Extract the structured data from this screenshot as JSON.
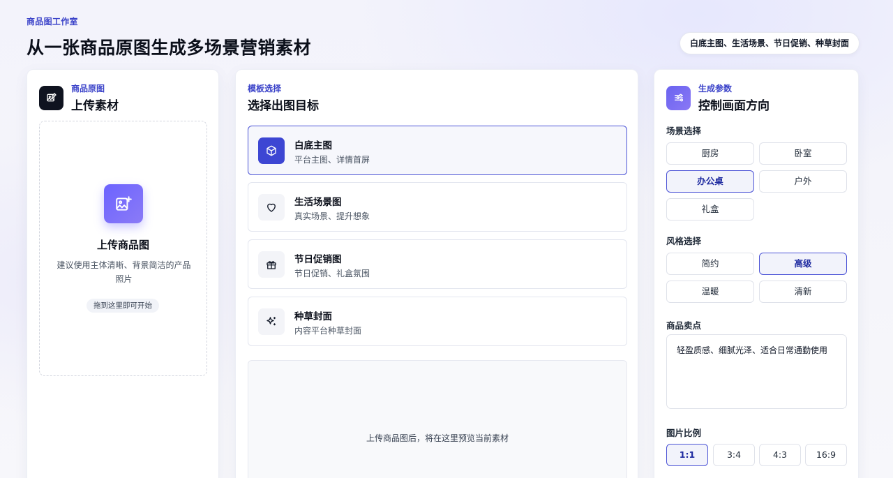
{
  "header": {
    "eyebrow": "商品图工作室",
    "title": "从一张商品原图生成多场景营销素材",
    "pill": "白底主图、生活场景、节日促销、种草封面"
  },
  "upload": {
    "sub": "商品原图",
    "title": "上传素材",
    "icon": "image-edit-icon",
    "drop_title": "上传商品图",
    "drop_desc": "建议使用主体清晰、背景简洁的产品照片",
    "drop_badge": "拖到这里即可开始",
    "drop_icon": "image-add-icon"
  },
  "templates": {
    "sub": "模板选择",
    "title": "选择出图目标",
    "items": [
      {
        "name": "白底主图",
        "desc": "平台主图、详情首屏",
        "icon": "cube-icon",
        "active": true
      },
      {
        "name": "生活场景图",
        "desc": "真实场景、提升想象",
        "icon": "heart-icon",
        "active": false
      },
      {
        "name": "节日促销图",
        "desc": "节日促销、礼盒氛围",
        "icon": "gift-icon",
        "active": false
      },
      {
        "name": "种草封面",
        "desc": "内容平台种草封面",
        "icon": "sparkle-icon",
        "active": false
      }
    ],
    "preview_text": "上传商品图后，将在这里预览当前素材"
  },
  "params": {
    "sub": "生成参数",
    "title": "控制画面方向",
    "icon": "sliders-icon",
    "scene_label": "场景选择",
    "scenes": [
      {
        "label": "厨房",
        "selected": false
      },
      {
        "label": "卧室",
        "selected": false
      },
      {
        "label": "办公桌",
        "selected": true
      },
      {
        "label": "户外",
        "selected": false
      },
      {
        "label": "礼盒",
        "selected": false
      }
    ],
    "style_label": "风格选择",
    "styles": [
      {
        "label": "简约",
        "selected": false
      },
      {
        "label": "高级",
        "selected": true
      },
      {
        "label": "温暖",
        "selected": false
      },
      {
        "label": "清新",
        "selected": false
      }
    ],
    "selling_label": "商品卖点",
    "selling_value": "轻盈质感、细腻光泽、适合日常通勤使用",
    "ratio_label": "图片比例",
    "ratios": [
      {
        "label": "1:1",
        "selected": true
      },
      {
        "label": "3:4",
        "selected": false
      },
      {
        "label": "4:3",
        "selected": false
      },
      {
        "label": "16:9",
        "selected": false
      }
    ]
  },
  "colors": {
    "accent": "#3b43c9",
    "accent_selected_border": "#4b53d6",
    "violet_start": "#6c63ff",
    "dark_icon_bg": "#0f1320"
  }
}
